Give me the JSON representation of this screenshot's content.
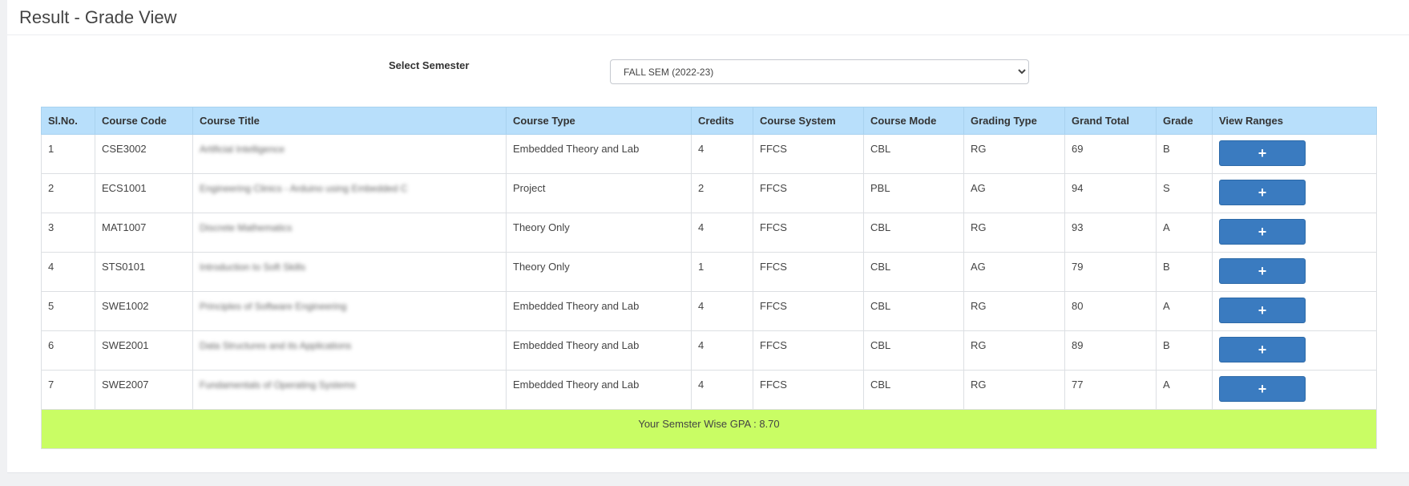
{
  "header": {
    "title": "Result - Grade View"
  },
  "semester": {
    "label": "Select Semester",
    "selected": "FALL SEM (2022-23)"
  },
  "table": {
    "columns": [
      "Sl.No.",
      "Course Code",
      "Course Title",
      "Course Type",
      "Credits",
      "Course System",
      "Course Mode",
      "Grading Type",
      "Grand Total",
      "Grade",
      "View Ranges"
    ],
    "rows": [
      {
        "sl": "1",
        "code": "CSE3002",
        "title": "Artificial Intelligence",
        "type": "Embedded Theory and Lab",
        "credits": "4",
        "system": "FFCS",
        "mode": "CBL",
        "grading": "RG",
        "total": "69",
        "grade": "B"
      },
      {
        "sl": "2",
        "code": "ECS1001",
        "title": "Engineering Clinics - Arduino using Embedded C",
        "type": "Project",
        "credits": "2",
        "system": "FFCS",
        "mode": "PBL",
        "grading": "AG",
        "total": "94",
        "grade": "S"
      },
      {
        "sl": "3",
        "code": "MAT1007",
        "title": "Discrete Mathematics",
        "type": "Theory Only",
        "credits": "4",
        "system": "FFCS",
        "mode": "CBL",
        "grading": "RG",
        "total": "93",
        "grade": "A"
      },
      {
        "sl": "4",
        "code": "STS0101",
        "title": "Introduction to Soft Skills",
        "type": "Theory Only",
        "credits": "1",
        "system": "FFCS",
        "mode": "CBL",
        "grading": "AG",
        "total": "79",
        "grade": "B"
      },
      {
        "sl": "5",
        "code": "SWE1002",
        "title": "Principles of Software Engineering",
        "type": "Embedded Theory and Lab",
        "credits": "4",
        "system": "FFCS",
        "mode": "CBL",
        "grading": "RG",
        "total": "80",
        "grade": "A"
      },
      {
        "sl": "6",
        "code": "SWE2001",
        "title": "Data Structures and its Applications",
        "type": "Embedded Theory and Lab",
        "credits": "4",
        "system": "FFCS",
        "mode": "CBL",
        "grading": "RG",
        "total": "89",
        "grade": "B"
      },
      {
        "sl": "7",
        "code": "SWE2007",
        "title": "Fundamentals of Operating Systems",
        "type": "Embedded Theory and Lab",
        "credits": "4",
        "system": "FFCS",
        "mode": "CBL",
        "grading": "RG",
        "total": "77",
        "grade": "A"
      }
    ],
    "view_button_label": "+"
  },
  "gpa": {
    "text": "Your Semster Wise GPA : 8.70"
  },
  "colors": {
    "header_bg": "#b8dffb",
    "gpa_bg": "#c9fd64",
    "button_bg": "#3a7bc0"
  }
}
